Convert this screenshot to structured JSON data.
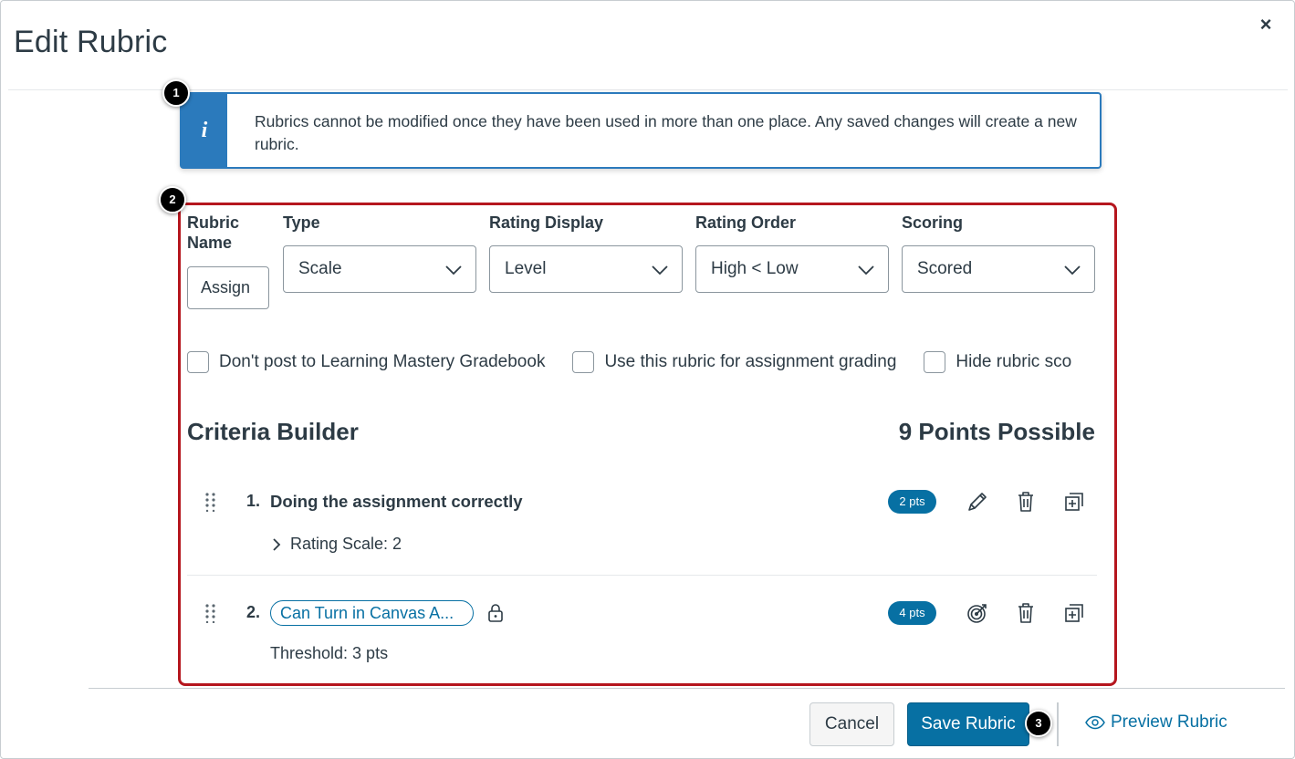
{
  "modal": {
    "title": "Edit Rubric",
    "close_label": "×"
  },
  "callouts": [
    "1",
    "2",
    "3"
  ],
  "alert": {
    "icon": "info-icon",
    "icon_glyph": "i",
    "message": "Rubrics cannot be modified once they have been used in more than one place. Any saved changes will create a new rubric."
  },
  "form": {
    "rubric_name_label": "Rubric Name",
    "rubric_name_value": "Assign",
    "type_label": "Type",
    "type_value": "Scale",
    "rating_display_label": "Rating Display",
    "rating_display_value": "Level",
    "rating_order_label": "Rating Order",
    "rating_order_value": "High < Low",
    "scoring_label": "Scoring",
    "scoring_value": "Scored"
  },
  "options": [
    {
      "label": "Don't post to Learning Mastery Gradebook",
      "checked": false
    },
    {
      "label": "Use this rubric for assignment grading",
      "checked": false
    },
    {
      "label": "Hide rubric sco",
      "checked": false
    }
  ],
  "criteria_builder": {
    "title": "Criteria Builder",
    "points_possible": "9 Points Possible",
    "criteria": [
      {
        "number": "1.",
        "title": "Doing the assignment correctly",
        "points": "2 pts",
        "details": "Rating Scale: 2",
        "edit_icon": "pencil-icon",
        "delete_icon": "trash-icon",
        "duplicate_icon": "duplicate-icon"
      },
      {
        "number": "2.",
        "title": "Can Turn in Canvas A...",
        "points": "4 pts",
        "details": "Threshold: 3 pts",
        "lock_icon": "lock-icon",
        "outcome_icon": "outcome-target-icon",
        "delete_icon": "trash-icon",
        "duplicate_icon": "duplicate-icon"
      }
    ]
  },
  "footer": {
    "cancel_label": "Cancel",
    "save_label": "Save Rubric",
    "preview_label": "Preview Rubric"
  },
  "colors": {
    "primary": "#0770a3",
    "info": "#2b7abc",
    "highlight_border": "#b5161e",
    "text": "#2d3b45"
  }
}
